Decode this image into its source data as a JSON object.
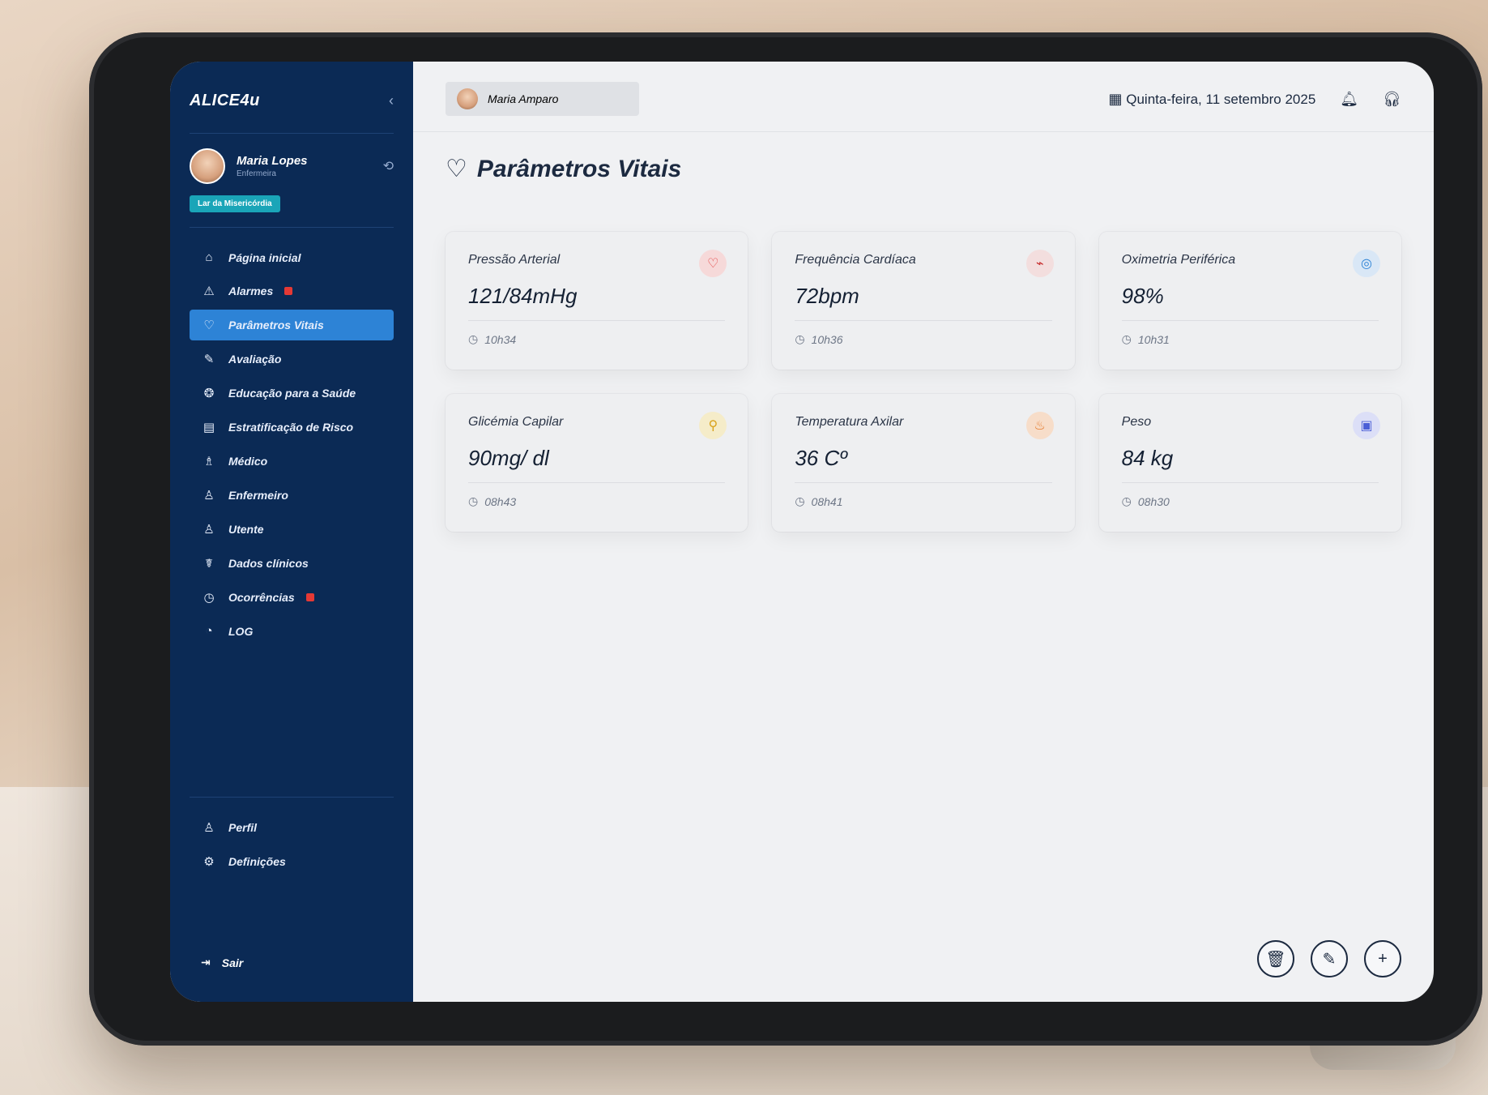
{
  "app": {
    "logo": "ALICE4u"
  },
  "user": {
    "name": "Maria Lopes",
    "role": "Enfermeira",
    "facility": "Lar da Misericórdia"
  },
  "sidebar": {
    "items": [
      {
        "label": "Página inicial",
        "icon": "home-icon",
        "glyph": "⌂"
      },
      {
        "label": "Alarmes",
        "icon": "warning-icon",
        "glyph": "⚠",
        "badge": true
      },
      {
        "label": "Parâmetros Vitais",
        "icon": "heart-icon",
        "glyph": "♡",
        "active": true
      },
      {
        "label": "Avaliação",
        "icon": "edit-icon",
        "glyph": "✎"
      },
      {
        "label": "Educação para a Saúde",
        "icon": "education-icon",
        "glyph": "❂"
      },
      {
        "label": "Estratificação de Risco",
        "icon": "chart-icon",
        "glyph": "▤"
      },
      {
        "label": "Médico",
        "icon": "doctor-icon",
        "glyph": "♗"
      },
      {
        "label": "Enfermeiro",
        "icon": "nurse-icon",
        "glyph": "♙"
      },
      {
        "label": "Utente",
        "icon": "user-icon",
        "glyph": "♙"
      },
      {
        "label": "Dados clínicos",
        "icon": "clinical-icon",
        "glyph": "☤"
      },
      {
        "label": "Ocorrências",
        "icon": "occurrence-icon",
        "glyph": "◷",
        "badge": true
      },
      {
        "label": "LOG",
        "icon": "log-icon",
        "glyph": "◔"
      }
    ],
    "bottom": [
      {
        "label": "Perfil",
        "icon": "profile-icon",
        "glyph": "♙"
      },
      {
        "label": "Definições",
        "icon": "settings-icon",
        "glyph": "⚙"
      }
    ],
    "logout": "Sair"
  },
  "topbar": {
    "patient": "Maria Amparo",
    "date": "Quinta-feira, 11 setembro 2025"
  },
  "page": {
    "title": "Parâmetros Vitais"
  },
  "cards": [
    {
      "label": "Pressão Arterial",
      "value": "121/84mHg",
      "time": "10h34",
      "icon": "heart-icon",
      "glyph": "♡",
      "color": "#e23b3b",
      "bg": "#f6d9d9"
    },
    {
      "label": "Frequência Cardíaca",
      "value": "72bpm",
      "time": "10h36",
      "icon": "pulse-icon",
      "glyph": "⌁",
      "color": "#c62828",
      "bg": "#f3dede"
    },
    {
      "label": "Oximetria Periférica",
      "value": "98%",
      "time": "10h31",
      "icon": "oxygen-icon",
      "glyph": "◎",
      "color": "#2d83d6",
      "bg": "#d9e7f6"
    },
    {
      "label": "Glicémia Capilar",
      "value": "90mg/ dl",
      "time": "08h43",
      "icon": "drop-icon",
      "glyph": "⚲",
      "color": "#d9a21b",
      "bg": "#f5ecc9"
    },
    {
      "label": "Temperatura Axilar",
      "value": "36 Cº",
      "time": "08h41",
      "icon": "thermometer-icon",
      "glyph": "🌡",
      "color": "#e67c2e",
      "bg": "#f7ddc9"
    },
    {
      "label": "Peso",
      "value": "84 kg",
      "time": "08h30",
      "icon": "scale-icon",
      "glyph": "▣",
      "color": "#4b5fd6",
      "bg": "#dcdff7"
    }
  ]
}
